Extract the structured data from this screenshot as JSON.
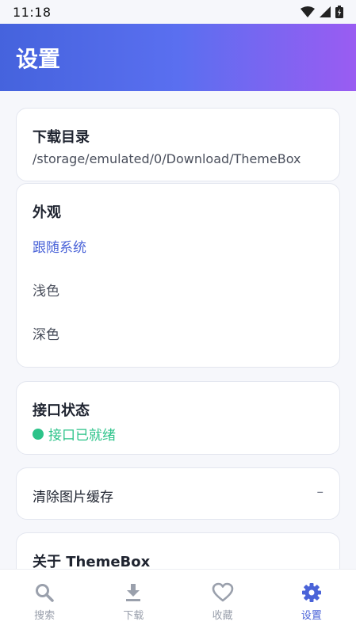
{
  "status_bar": {
    "time": "11:18"
  },
  "header": {
    "title": "设置"
  },
  "download_card": {
    "title": "下载目录",
    "path": "/storage/emulated/0/Download/ThemeBox"
  },
  "appearance_card": {
    "title": "外观",
    "options": [
      {
        "label": "跟随系统",
        "selected": true
      },
      {
        "label": "浅色",
        "selected": false
      },
      {
        "label": "深色",
        "selected": false
      }
    ]
  },
  "api_card": {
    "title": "接口状态",
    "status": "接口已就绪",
    "status_color": "#2cc389"
  },
  "cache_card": {
    "label": "清除图片缓存",
    "value": "–"
  },
  "about_card": {
    "title": "关于 ThemeBox"
  },
  "tabbar": {
    "items": [
      {
        "label": "搜索",
        "icon": "search-icon",
        "active": false
      },
      {
        "label": "下载",
        "icon": "download-icon",
        "active": false
      },
      {
        "label": "收藏",
        "icon": "heart-icon",
        "active": false
      },
      {
        "label": "设置",
        "icon": "gear-icon",
        "active": true
      }
    ]
  },
  "colors": {
    "accent": "#4a63d8",
    "inactive": "#9aa0ac"
  }
}
